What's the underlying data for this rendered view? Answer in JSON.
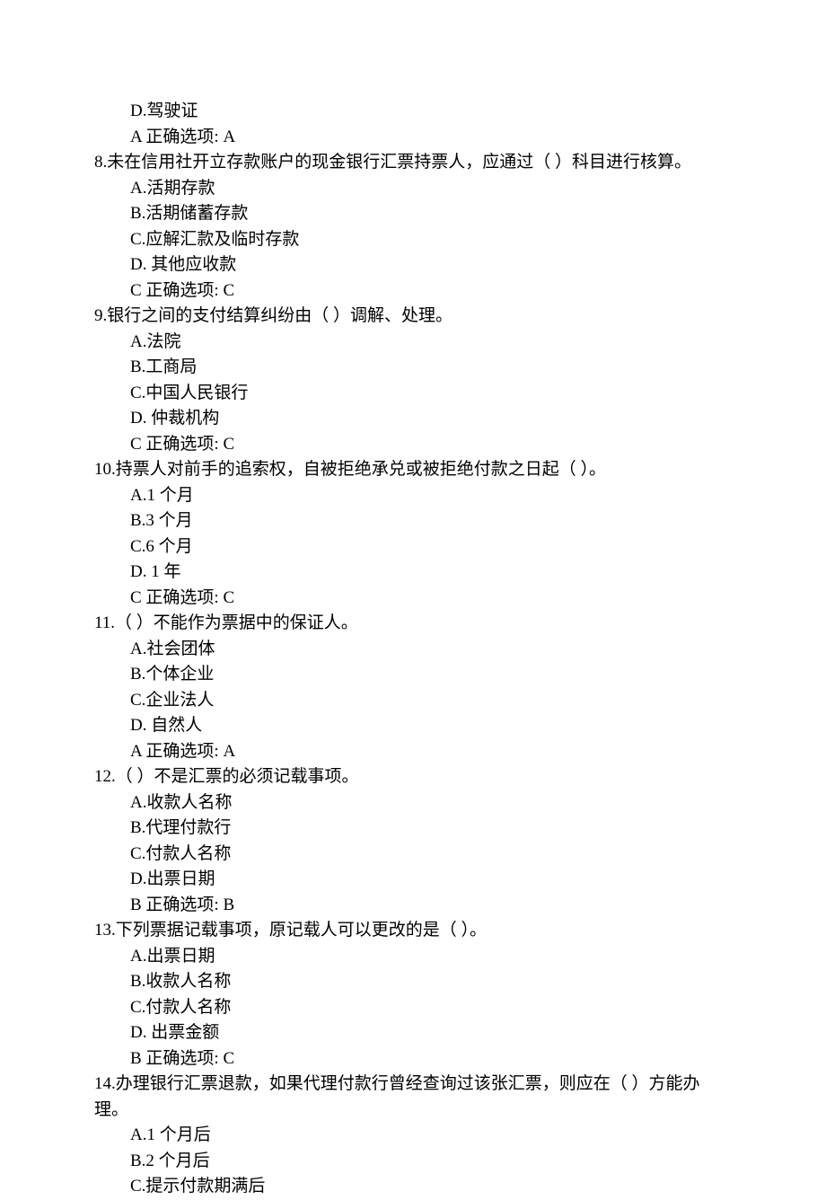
{
  "lines": [
    {
      "cls": "indent",
      "text": "D.驾驶证"
    },
    {
      "cls": "indent",
      "text": "A  正确选项: A"
    },
    {
      "cls": "q",
      "text": "8.未在信用社开立存款账户的现金银行汇票持票人，应通过（ ）科目进行核算。"
    },
    {
      "cls": "indent",
      "text": "A.活期存款"
    },
    {
      "cls": "indent",
      "text": "B.活期储蓄存款"
    },
    {
      "cls": "indent",
      "text": "C.应解汇款及临时存款"
    },
    {
      "cls": "indent",
      "text": "D. 其他应收款"
    },
    {
      "cls": "indent",
      "text": "C  正确选项: C"
    },
    {
      "cls": "q",
      "text": "9.银行之间的支付结算纠纷由（ ）调解、处理。"
    },
    {
      "cls": "indent",
      "text": "A.法院"
    },
    {
      "cls": "indent",
      "text": "B.工商局"
    },
    {
      "cls": "indent",
      "text": "C.中国人民银行"
    },
    {
      "cls": "indent",
      "text": "D. 仲裁机构"
    },
    {
      "cls": "indent",
      "text": "C  正确选项: C"
    },
    {
      "cls": "q",
      "text": "10.持票人对前手的追索权，自被拒绝承兑或被拒绝付款之日起（ ）。"
    },
    {
      "cls": "indent",
      "text": "A.1 个月"
    },
    {
      "cls": "indent",
      "text": "B.3 个月"
    },
    {
      "cls": "indent",
      "text": "C.6 个月"
    },
    {
      "cls": "indent",
      "text": "D. 1 年"
    },
    {
      "cls": "indent",
      "text": "C  正确选项: C"
    },
    {
      "cls": "q",
      "text": "11.（ ）不能作为票据中的保证人。"
    },
    {
      "cls": "indent",
      "text": "A.社会团体"
    },
    {
      "cls": "indent",
      "text": "B.个体企业"
    },
    {
      "cls": "indent",
      "text": "C.企业法人"
    },
    {
      "cls": "indent",
      "text": "D. 自然人"
    },
    {
      "cls": "indent",
      "text": "A  正确选项: A"
    },
    {
      "cls": "q",
      "text": "12.（ ）不是汇票的必须记载事项。"
    },
    {
      "cls": "indent",
      "text": "A.收款人名称"
    },
    {
      "cls": "indent",
      "text": "B.代理付款行"
    },
    {
      "cls": "indent",
      "text": "C.付款人名称"
    },
    {
      "cls": "indent",
      "text": "D.出票日期"
    },
    {
      "cls": "indent",
      "text": "B  正确选项: B"
    },
    {
      "cls": "q",
      "text": "13.下列票据记载事项，原记载人可以更改的是（ ）。"
    },
    {
      "cls": "indent",
      "text": "A.出票日期"
    },
    {
      "cls": "indent",
      "text": "B.收款人名称"
    },
    {
      "cls": "indent",
      "text": "C.付款人名称"
    },
    {
      "cls": "indent",
      "text": "D. 出票金额"
    },
    {
      "cls": "indent",
      "text": "B  正确选项: C"
    },
    {
      "cls": "q",
      "text": "14.办理银行汇票退款，如果代理付款行曾经查询过该张汇票，则应在（ ）方能办理。"
    },
    {
      "cls": "indent",
      "text": "A.1 个月后"
    },
    {
      "cls": "indent",
      "text": "B.2 个月后"
    },
    {
      "cls": "indent",
      "text": "C.提示付款期满后"
    }
  ]
}
